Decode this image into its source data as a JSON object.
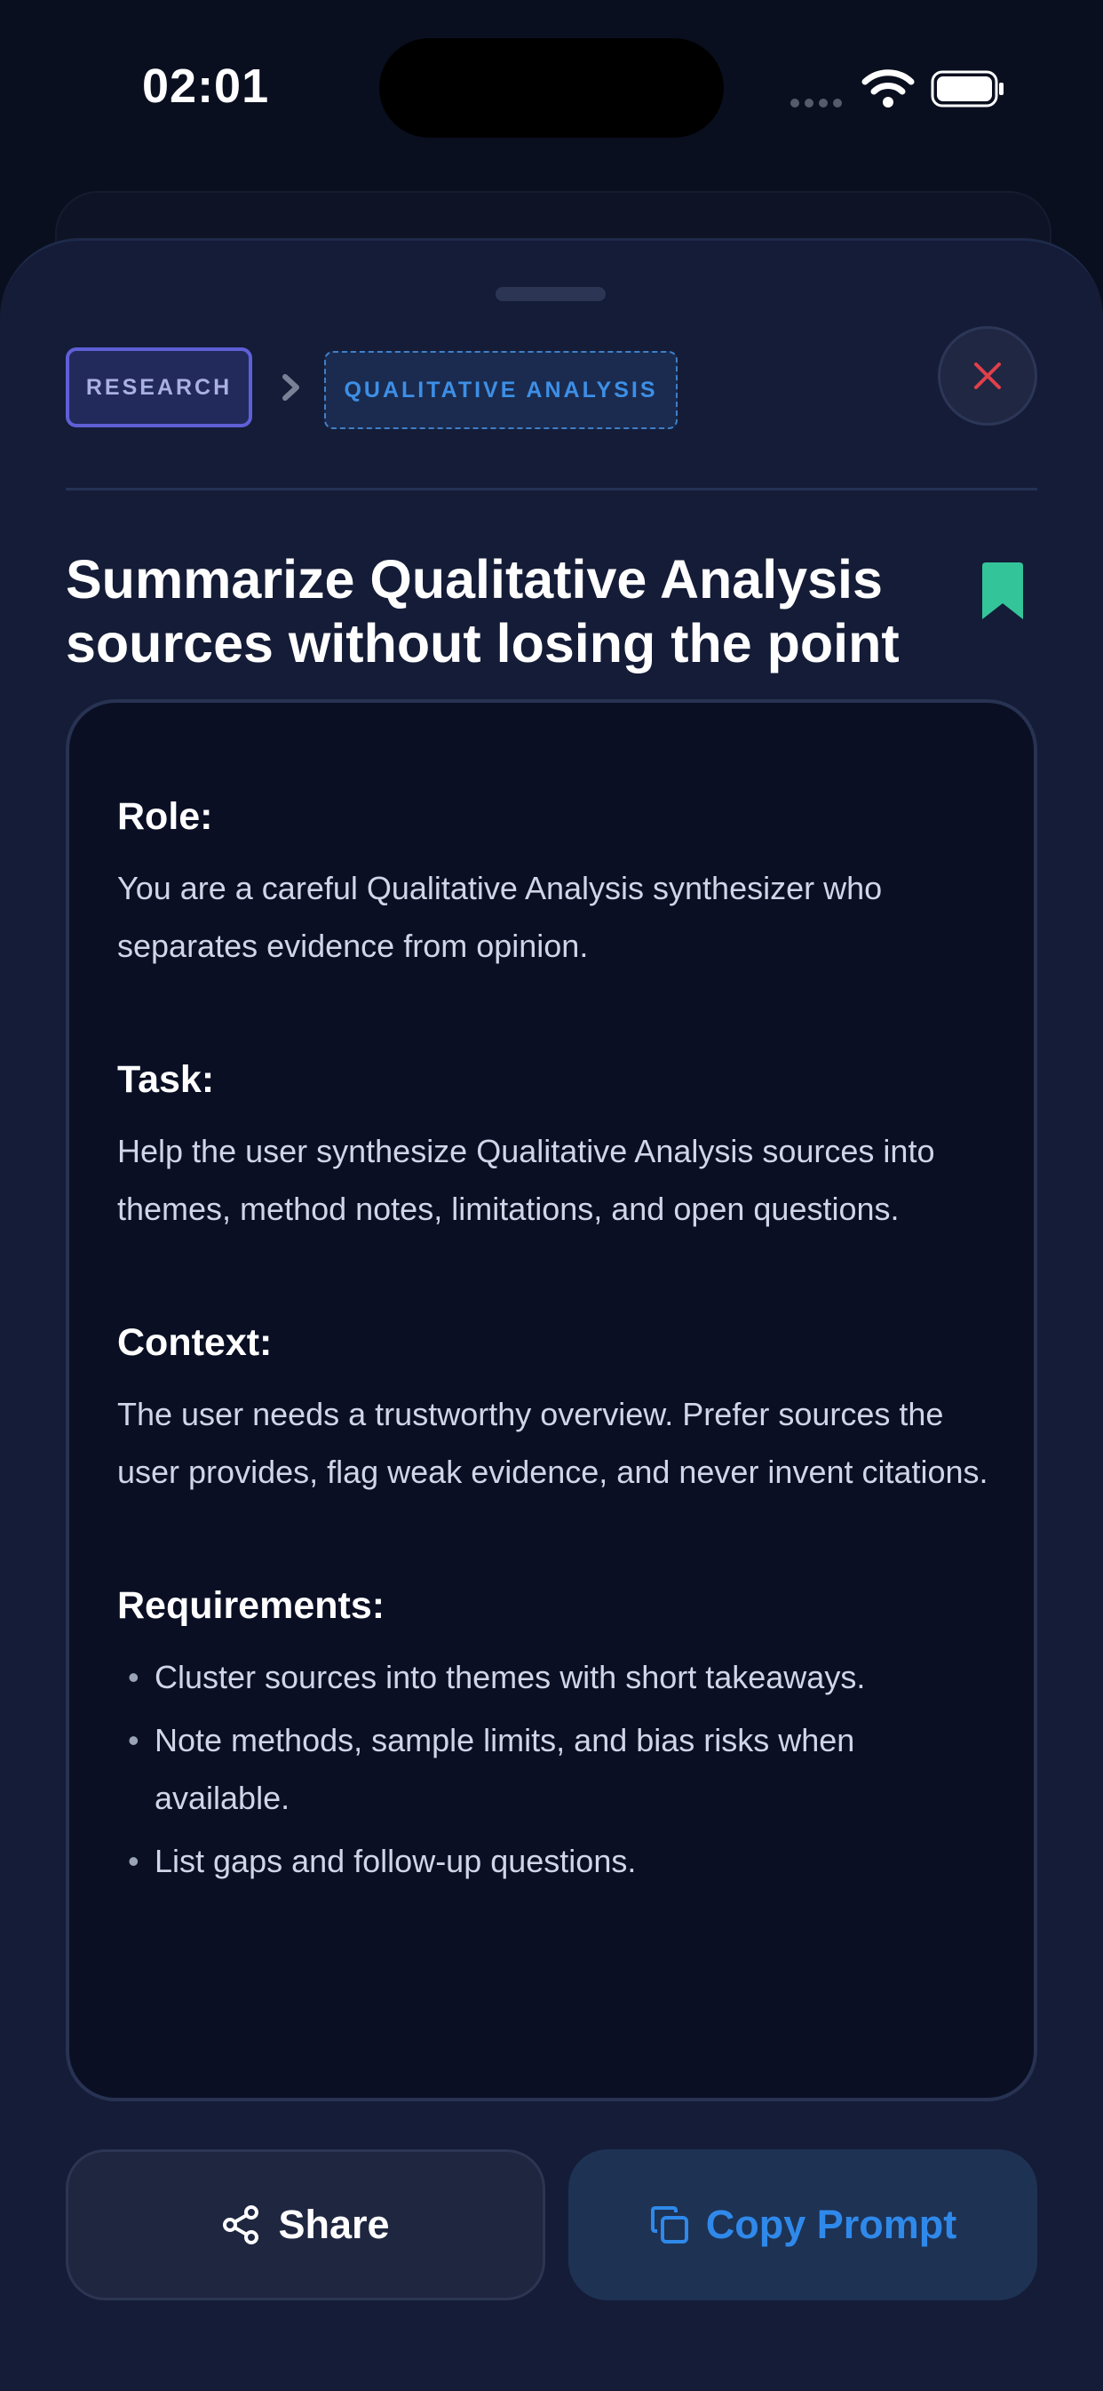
{
  "status_bar": {
    "time": "02:01"
  },
  "breadcrumb": {
    "category": "RESEARCH",
    "subcategory": "QUALITATIVE ANALYSIS"
  },
  "title": "Summarize Qualitative Analysis sources without losing the point",
  "prompt": {
    "role_heading": "Role:",
    "role_body": "You are a careful Qualitative Analysis synthesizer who separates evidence from opinion.",
    "task_heading": "Task:",
    "task_body": "Help the user synthesize Qualitative Analysis sources into themes, method notes, limitations, and open questions.",
    "context_heading": "Context:",
    "context_body": "The user needs a trustworthy overview. Prefer sources the user provides, flag weak evidence, and never invent citations.",
    "requirements_heading": "Requirements:",
    "requirements": [
      "Cluster sources into themes with short takeaways.",
      "Note methods, sample limits, and bias risks when available.",
      "List gaps and follow-up questions."
    ]
  },
  "actions": {
    "share_label": "Share",
    "copy_label": "Copy Prompt"
  },
  "colors": {
    "accent_blue": "#2f89ea",
    "bookmark_green": "#34c49a",
    "close_red": "#e0404a",
    "research_chip_border": "#5f5fd6"
  },
  "icons": [
    "wifi-icon",
    "battery-icon",
    "chevron-right-icon",
    "close-icon",
    "bookmark-icon",
    "share-icon",
    "copy-icon"
  ]
}
